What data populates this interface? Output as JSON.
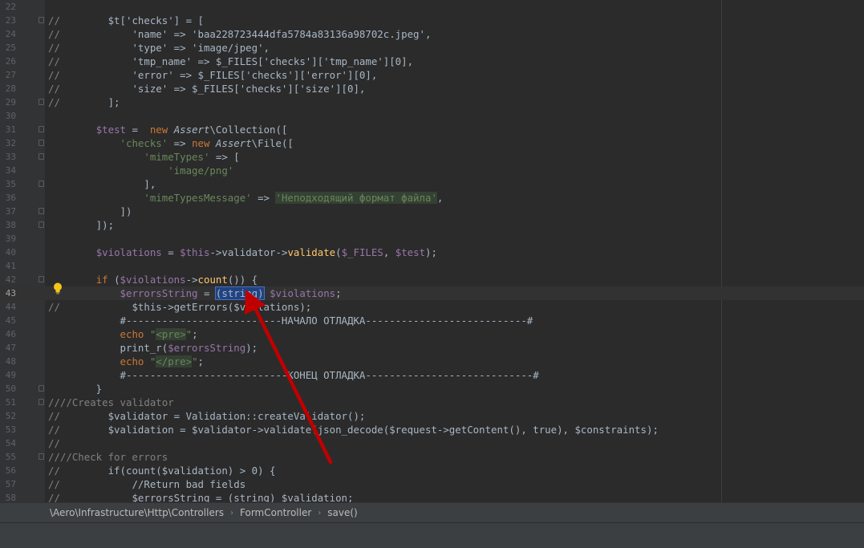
{
  "editor": {
    "current_line": "43",
    "lines": [
      {
        "n": "22",
        "tokens": []
      },
      {
        "n": "23",
        "tokens": [
          [
            "c",
            "//"
          ],
          [
            "p",
            "        $t['checks'] = ["
          ]
        ]
      },
      {
        "n": "24",
        "tokens": [
          [
            "c",
            "//"
          ],
          [
            "p",
            "            'name' => 'baa228723444dfa5784a83136a98702c.jpeg',"
          ]
        ]
      },
      {
        "n": "25",
        "tokens": [
          [
            "c",
            "//"
          ],
          [
            "p",
            "            'type' => 'image/jpeg',"
          ]
        ]
      },
      {
        "n": "26",
        "tokens": [
          [
            "c",
            "//"
          ],
          [
            "p",
            "            'tmp_name' => $_FILES['checks']['tmp_name'][0],"
          ]
        ]
      },
      {
        "n": "27",
        "tokens": [
          [
            "c",
            "//"
          ],
          [
            "p",
            "            'error' => $_FILES['checks']['error'][0],"
          ]
        ]
      },
      {
        "n": "28",
        "tokens": [
          [
            "c",
            "//"
          ],
          [
            "p",
            "            'size' => $_FILES['checks']['size'][0],"
          ]
        ]
      },
      {
        "n": "29",
        "tokens": [
          [
            "c",
            "//"
          ],
          [
            "p",
            "        ];"
          ]
        ]
      },
      {
        "n": "30",
        "tokens": []
      },
      {
        "n": "31",
        "tokens": [
          [
            "p",
            "        "
          ],
          [
            "v",
            "$test"
          ],
          [
            "p",
            " =  "
          ],
          [
            "k",
            "new "
          ],
          [
            "i",
            "Assert"
          ],
          [
            "p",
            "\\Collection(["
          ]
        ]
      },
      {
        "n": "32",
        "tokens": [
          [
            "p",
            "            "
          ],
          [
            "s",
            "'checks'"
          ],
          [
            "p",
            " => "
          ],
          [
            "k",
            "new "
          ],
          [
            "i",
            "Assert"
          ],
          [
            "p",
            "\\File(["
          ]
        ]
      },
      {
        "n": "33",
        "tokens": [
          [
            "p",
            "                "
          ],
          [
            "s",
            "'mimeTypes'"
          ],
          [
            "p",
            " => ["
          ]
        ]
      },
      {
        "n": "34",
        "tokens": [
          [
            "p",
            "                    "
          ],
          [
            "s",
            "'image/png'"
          ]
        ]
      },
      {
        "n": "35",
        "tokens": [
          [
            "p",
            "                ],"
          ]
        ]
      },
      {
        "n": "36",
        "tokens": [
          [
            "p",
            "                "
          ],
          [
            "s",
            "'mimeTypesMessage'"
          ],
          [
            "p",
            " => "
          ],
          [
            "h",
            "'Неподходящий формат файла'"
          ],
          [
            "p",
            ","
          ]
        ]
      },
      {
        "n": "37",
        "tokens": [
          [
            "p",
            "            ])"
          ]
        ]
      },
      {
        "n": "38",
        "tokens": [
          [
            "p",
            "        ]);"
          ]
        ]
      },
      {
        "n": "39",
        "tokens": []
      },
      {
        "n": "40",
        "tokens": [
          [
            "p",
            "        "
          ],
          [
            "v",
            "$violations"
          ],
          [
            "p",
            " = "
          ],
          [
            "v",
            "$this"
          ],
          [
            "p",
            "->validator->"
          ],
          [
            "f",
            "validate"
          ],
          [
            "p",
            "("
          ],
          [
            "v",
            "$_FILES"
          ],
          [
            "p",
            ", "
          ],
          [
            "v",
            "$test"
          ],
          [
            "p",
            ");"
          ]
        ]
      },
      {
        "n": "41",
        "tokens": []
      },
      {
        "n": "42",
        "tokens": [
          [
            "p",
            "        "
          ],
          [
            "k",
            "if "
          ],
          [
            "p",
            "("
          ],
          [
            "v",
            "$violations"
          ],
          [
            "p",
            "->"
          ],
          [
            "f",
            "count"
          ],
          [
            "p",
            "()) {"
          ]
        ]
      },
      {
        "n": "43",
        "tokens": [
          [
            "p",
            "            "
          ],
          [
            "v",
            "$errorsString"
          ],
          [
            "p",
            " = "
          ],
          [
            "x",
            "(string)"
          ],
          [
            "p",
            " "
          ],
          [
            "v",
            "$violations"
          ],
          [
            "p",
            ";"
          ]
        ]
      },
      {
        "n": "44",
        "tokens": [
          [
            "c",
            "//"
          ],
          [
            "p",
            "            $this->getErrors($violations);"
          ]
        ]
      },
      {
        "n": "45",
        "tokens": [
          [
            "p",
            "            #--------------------------НАЧАЛО ОТЛАДКА---------------------------#"
          ]
        ]
      },
      {
        "n": "46",
        "tokens": [
          [
            "p",
            "            "
          ],
          [
            "k",
            "echo "
          ],
          [
            "s",
            "\""
          ],
          [
            "h",
            "<pre>"
          ],
          [
            "s",
            "\""
          ],
          [
            "p",
            ";"
          ]
        ]
      },
      {
        "n": "47",
        "tokens": [
          [
            "p",
            "            print_r("
          ],
          [
            "v",
            "$errorsString"
          ],
          [
            "p",
            ");"
          ]
        ]
      },
      {
        "n": "48",
        "tokens": [
          [
            "p",
            "            "
          ],
          [
            "k",
            "echo "
          ],
          [
            "s",
            "\""
          ],
          [
            "h",
            "</pre>"
          ],
          [
            "s",
            "\""
          ],
          [
            "p",
            ";"
          ]
        ]
      },
      {
        "n": "49",
        "tokens": [
          [
            "p",
            "            #---------------------------КОНЕЦ ОТЛАДКА----------------------------#"
          ]
        ]
      },
      {
        "n": "50",
        "tokens": [
          [
            "p",
            "        }"
          ]
        ]
      },
      {
        "n": "51",
        "tokens": [
          [
            "c",
            "////Creates validator"
          ]
        ]
      },
      {
        "n": "52",
        "tokens": [
          [
            "c",
            "//"
          ],
          [
            "p",
            "        $validator = Validation::createValidator();"
          ]
        ]
      },
      {
        "n": "53",
        "tokens": [
          [
            "c",
            "//"
          ],
          [
            "p",
            "        $validation = $validator->validate(json_decode($request->getContent(), true), $constraints);"
          ]
        ]
      },
      {
        "n": "54",
        "tokens": [
          [
            "c",
            "//"
          ]
        ]
      },
      {
        "n": "55",
        "tokens": [
          [
            "c",
            "////Check for errors"
          ]
        ]
      },
      {
        "n": "56",
        "tokens": [
          [
            "c",
            "//"
          ],
          [
            "p",
            "        if(count($validation) > 0) {"
          ]
        ]
      },
      {
        "n": "57",
        "tokens": [
          [
            "c",
            "//"
          ],
          [
            "p",
            "            //Return bad fields"
          ]
        ]
      },
      {
        "n": "58",
        "tokens": [
          [
            "c",
            "//"
          ],
          [
            "p",
            "            $errorsString = (string) $validation;"
          ]
        ]
      }
    ]
  },
  "icons": {
    "intention_bulb": "lightbulb-icon",
    "annotation_arrow": "red-arrow-annotation"
  },
  "colors": {
    "background": "#2b2b2b",
    "keyword": "#cc7832",
    "string": "#6a8759",
    "variable": "#9876aa",
    "function": "#ffc66d",
    "arrow": "#c00000"
  },
  "breadcrumb": {
    "namespace": "\\Aero\\Infrastructure\\Http\\Controllers",
    "class": "FormController",
    "method": "save()"
  }
}
